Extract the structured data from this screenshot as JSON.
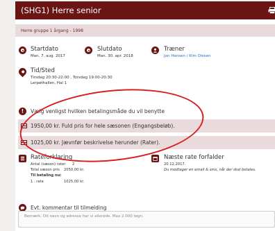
{
  "header": {
    "title": "(SHG1) Herre senior"
  },
  "subline": "Herre gruppe 1 årgang - 1998",
  "info": {
    "start": {
      "label": "Startdato",
      "value": "Man. 7. aug. 2017"
    },
    "end": {
      "label": "Slutdato",
      "value": "Man. 30. apr. 2018"
    },
    "trainer": {
      "label": "Træner",
      "value": "Jan Hansen / Kim Olesen"
    },
    "time": {
      "label": "Tid/Sted",
      "line1": "Tirsdag 20:30-22:00 , Torsdag 19:00-20:30",
      "line2": "Lerpøthallen, Hal 1"
    }
  },
  "payment": {
    "notice": "Vælg venligst hvilken betalingsmåde du vil benytte",
    "options": [
      {
        "label": "1950,00 kr. Fuld pris for hele sæsonen (Engangsbeløb)."
      },
      {
        "label": "1025,00 kr. Jævnfør beskrivelse herunder (Rater)."
      }
    ]
  },
  "rate": {
    "title": "Rateforklaring",
    "rows": [
      {
        "label": "Antal (sæson) rater",
        "value": "2"
      },
      {
        "label": "Total sæson pris",
        "value": "2050,00 kr."
      }
    ],
    "pay_now": "Til betaling nu:",
    "first": {
      "label": "1 . rate",
      "value": "1025,00 kr."
    },
    "next": {
      "label": "Næste rate forfalder",
      "date": "20.12.2017.",
      "note": "Du modtager en email & sms, når der skal betales."
    }
  },
  "comment": {
    "label": "Evt. kommentar til tilmelding",
    "placeholder": "Bemærk. Dit navn og adresse har vi allerede. Max 2.000 tegn."
  },
  "colors": {
    "brand": "#6b1414",
    "highlight_row": "#e9dadb",
    "annotation": "#d81f1f"
  }
}
